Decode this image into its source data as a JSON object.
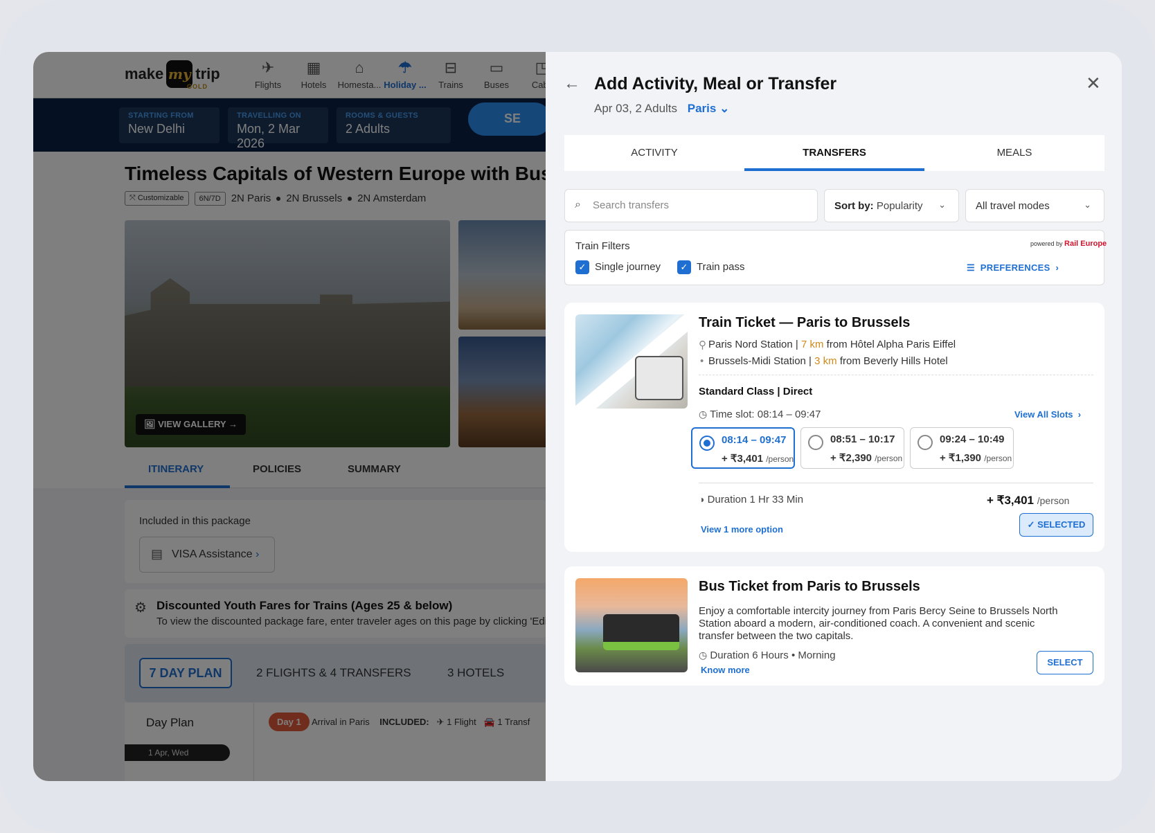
{
  "background": {
    "logo": {
      "text1": "make",
      "text2": "my",
      "text3": "trip",
      "gold": "GOLD"
    },
    "nav": [
      {
        "label": "Flights",
        "icon": "airplane-icon",
        "active": false
      },
      {
        "label": "Hotels",
        "icon": "hotel-icon",
        "active": false
      },
      {
        "label": "Homesta...",
        "icon": "homestay-icon",
        "active": false
      },
      {
        "label": "Holiday ...",
        "icon": "holiday-icon",
        "active": true
      },
      {
        "label": "Trains",
        "icon": "train-icon",
        "active": false
      },
      {
        "label": "Buses",
        "icon": "bus-icon",
        "active": false
      },
      {
        "label": "Cabs",
        "icon": "cab-icon",
        "active": false
      }
    ],
    "search": {
      "from_label": "STARTING FROM",
      "from_value": "New Delhi",
      "date_label": "TRAVELLING ON",
      "date_value": "Mon, 2 Mar 2026",
      "rooms_label": "ROOMS & GUESTS",
      "rooms_value": "2 Adults",
      "button": "SE"
    },
    "package_title": "Timeless Capitals of Western Europe with Bus",
    "tags": {
      "customizable": "Customizable",
      "duration": "6N/7D",
      "stops": [
        "2N Paris",
        "2N Brussels",
        "2N Amsterdam"
      ]
    },
    "view_gallery": "VIEW GALLERY",
    "tabs": [
      "ITINERARY",
      "POLICIES",
      "SUMMARY"
    ],
    "included_title": "Included in this package",
    "visa": "VISA Assistance",
    "discount_title": "Discounted Youth Fares for Trains (Ages 25 & below)",
    "discount_text": "To view the discounted package fare, enter traveler ages on this page by clicking 'Edit",
    "plan_tabs": [
      "7 DAY PLAN",
      "2 FLIGHTS & 4 TRANSFERS",
      "3 HOTELS"
    ],
    "day_plan": "Day Plan",
    "day_chip": "Day 1",
    "day_info": "Arrival in Paris",
    "included_label": "INCLUDED:",
    "inc_flight": "1 Flight",
    "inc_transfer": "1 Transf",
    "date_chip": "1 Apr, Wed"
  },
  "panel": {
    "title": "Add Activity, Meal or Transfer",
    "subtitle": "Apr 03, 2 Adults",
    "city": "Paris",
    "tabs": [
      "ACTIVITY",
      "TRANSFERS",
      "MEALS"
    ],
    "active_tab": "TRANSFERS",
    "search_placeholder": "Search transfers",
    "sort_label": "Sort by:",
    "sort_value": "Popularity",
    "modes": "All travel modes",
    "filters": {
      "title": "Train Filters",
      "powered_by": "powered by",
      "brand": "Rail Europe",
      "single": "Single journey",
      "pass": "Train pass",
      "preferences": "PREFERENCES"
    },
    "train": {
      "title": "Train Ticket — Paris to Brussels",
      "from_station": "Paris Nord Station",
      "from_km": "7 km",
      "from_place": "from Hôtel Alpha Paris Eiffel",
      "to_station": "Brussels-Midi Station",
      "to_km": "3 km",
      "to_place": "from Beverly Hills Hotel",
      "class": "Standard Class | Direct",
      "slot": "Time slot: 08:14 – 09:47",
      "view_all": "View All Slots",
      "options": [
        {
          "time": "08:14 – 09:47",
          "price": "+ ₹3,401",
          "unit": "/person",
          "selected": true
        },
        {
          "time": "08:51 – 10:17",
          "price": "+ ₹2,390",
          "unit": "/person",
          "selected": false
        },
        {
          "time": "09:24 – 10:49",
          "price": "+ ₹1,390",
          "unit": "/person",
          "selected": false
        }
      ],
      "duration": "Duration 1 Hr 33 Min",
      "total": "+ ₹3,401",
      "total_unit": "/person",
      "more": "View 1 more option",
      "selected_btn": "SELECTED"
    },
    "bus": {
      "title": "Bus Ticket from Paris to Brussels",
      "desc": "Enjoy a comfortable intercity journey from Paris Bercy Seine to Brussels North Station aboard a modern, air-conditioned coach. A convenient and scenic transfer between the two capitals.",
      "duration": "Duration 6 Hours",
      "time": "Morning",
      "know_more": "Know more",
      "select_btn": "SELECT"
    }
  },
  "colors": {
    "accent": "#1e6fd1",
    "navy": "#0a2344",
    "km": "#d08a1a"
  }
}
